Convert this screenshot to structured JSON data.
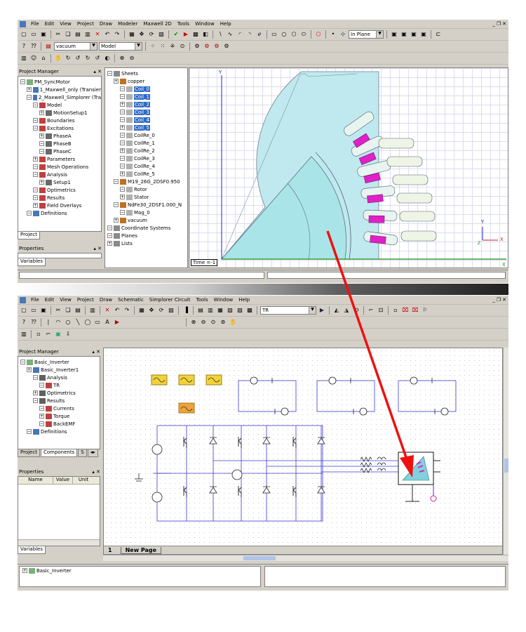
{
  "maxwell": {
    "menu": [
      "File",
      "Edit",
      "View",
      "Project",
      "Draw",
      "Modeler",
      "Maxwell 2D",
      "Tools",
      "Window",
      "Help"
    ],
    "combo_material": "vacuum",
    "combo_mode": "Model",
    "combo_plane": "In Plane",
    "project_manager_title": "Project Manager",
    "project_tree": [
      {
        "label": "PM_SyncMotor",
        "level": 0
      },
      {
        "label": "1_Maxwell_only (Transier",
        "level": 1
      },
      {
        "label": "2_Maxwell_Simplorer (Tra",
        "level": 1
      },
      {
        "label": "Model",
        "level": 2
      },
      {
        "label": "MotionSetup1",
        "level": 3
      },
      {
        "label": "Boundaries",
        "level": 2
      },
      {
        "label": "Excitations",
        "level": 2
      },
      {
        "label": "PhaseA",
        "level": 3
      },
      {
        "label": "PhaseB",
        "level": 3
      },
      {
        "label": "PhaseC",
        "level": 3
      },
      {
        "label": "Parameters",
        "level": 2
      },
      {
        "label": "Mesh Operations",
        "level": 2
      },
      {
        "label": "Analysis",
        "level": 2
      },
      {
        "label": "Setup1",
        "level": 3
      },
      {
        "label": "Optimetrics",
        "level": 2
      },
      {
        "label": "Results",
        "level": 2
      },
      {
        "label": "Field Overlays",
        "level": 2
      },
      {
        "label": "Definitions",
        "level": 1
      }
    ],
    "project_tab": "Project",
    "properties_title": "Properties",
    "variables_tab": "Variables",
    "model_tree": [
      {
        "label": "Sheets",
        "level": 0
      },
      {
        "label": "copper",
        "level": 1
      },
      {
        "label": "Coil_0",
        "level": 2,
        "selected": true
      },
      {
        "label": "Coil_1",
        "level": 2,
        "selected": true
      },
      {
        "label": "Coil_2",
        "level": 2,
        "selected": true
      },
      {
        "label": "Coil_3",
        "level": 2,
        "selected": true
      },
      {
        "label": "Coil_4",
        "level": 2,
        "selected": true
      },
      {
        "label": "Coil_5",
        "level": 2,
        "selected": true
      },
      {
        "label": "CoilRe_0",
        "level": 2
      },
      {
        "label": "CoilRe_1",
        "level": 2
      },
      {
        "label": "CoilRe_2",
        "level": 2
      },
      {
        "label": "CoilRe_3",
        "level": 2
      },
      {
        "label": "CoilRe_4",
        "level": 2
      },
      {
        "label": "CoilRe_5",
        "level": 2
      },
      {
        "label": "M19_26G_2DSF0.950",
        "level": 1
      },
      {
        "label": "Rotor",
        "level": 2
      },
      {
        "label": "Stator",
        "level": 2
      },
      {
        "label": "NdFe30_2DSF1.000_N",
        "level": 1
      },
      {
        "label": "Mag_0",
        "level": 2
      },
      {
        "label": "vacuum",
        "level": 1
      },
      {
        "label": "Coordinate Systems",
        "level": 0
      },
      {
        "label": "Planes",
        "level": 0
      },
      {
        "label": "Lists",
        "level": 0
      }
    ],
    "time_label": "Time =-1",
    "axis_y": "Y",
    "axis_x": "X",
    "axis_z": "Z"
  },
  "simplorer": {
    "menu": [
      "File",
      "Edit",
      "View",
      "Project",
      "Draw",
      "Schematic",
      "Simplorer Circuit",
      "Tools",
      "Window",
      "Help"
    ],
    "combo_setup": "TR",
    "project_manager_title": "Project Manager",
    "project_tree": [
      {
        "label": "Basic_Inverter",
        "level": 0
      },
      {
        "label": "Basic_Inverter1",
        "level": 1
      },
      {
        "label": "Analysis",
        "level": 2
      },
      {
        "label": "TR",
        "level": 3
      },
      {
        "label": "Optimetrics",
        "level": 2
      },
      {
        "label": "Results",
        "level": 2
      },
      {
        "label": "Currents",
        "level": 3
      },
      {
        "label": "Torque",
        "level": 3
      },
      {
        "label": "BackEMF",
        "level": 3
      },
      {
        "label": "Definitions",
        "level": 1
      }
    ],
    "tabs": [
      "Project",
      "Components",
      "S"
    ],
    "properties_title": "Properties",
    "prop_headers": [
      "Name",
      "Value",
      "Unit"
    ],
    "variables_tab": "Variables",
    "page_number": "1",
    "page_tab": "New Page",
    "message_item": "Basic_Inverter"
  },
  "colors": {
    "coil": "#e020c8",
    "stator": "#b8e8ec",
    "rotor": "#a8e4e6",
    "wire": "#3a3ad0",
    "arrow": "#ee1111",
    "selection": "#316ac5"
  }
}
